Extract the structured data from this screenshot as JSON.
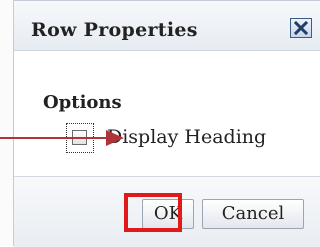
{
  "dialog": {
    "title": "Row Properties",
    "close_icon": "close-x-icon"
  },
  "options": {
    "heading": "Options",
    "display_heading": {
      "label": "Display Heading",
      "checked": false
    }
  },
  "buttons": {
    "ok_label": "OK",
    "cancel_label": "Cancel"
  },
  "annotations": {
    "highlight_color": "#e01a1a",
    "arrow_color": "#b0333a"
  }
}
